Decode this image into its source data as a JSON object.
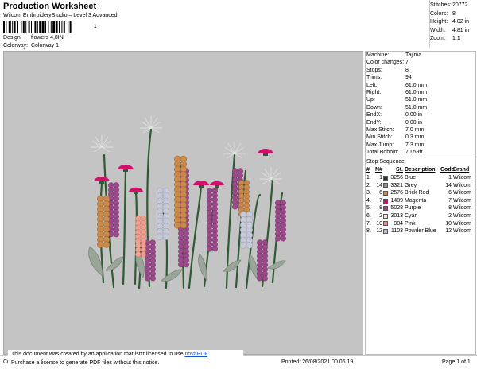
{
  "header": {
    "title": "Production Worksheet",
    "subtitle": "Wilcom EmbroideryStudio – Level 3 Advanced",
    "barcode_suffix": "1",
    "design_label": "Design:",
    "design_value": "flowers 4,8IN",
    "colorway_label": "Colorway:",
    "colorway_value": "Colorway 1"
  },
  "summary": [
    {
      "label": "Stitches:",
      "value": "20772"
    },
    {
      "label": "Colors:",
      "value": "8"
    },
    {
      "label": "Height:",
      "value": "4.02 in"
    },
    {
      "label": "Width:",
      "value": "4.81 in"
    },
    {
      "label": "Zoom:",
      "value": "1:1"
    }
  ],
  "machine_info": [
    {
      "label": "Machine:",
      "value": "Tajima"
    },
    {
      "label": "Color changes:",
      "value": "7"
    },
    {
      "label": "Stops:",
      "value": "8"
    },
    {
      "label": "Trims:",
      "value": "94"
    },
    {
      "label": "Left:",
      "value": "61.0 mm"
    },
    {
      "label": "Right:",
      "value": "61.0 mm"
    },
    {
      "label": "Up:",
      "value": "51.0 mm"
    },
    {
      "label": "Down:",
      "value": "51.0 mm"
    },
    {
      "label": "EndX:",
      "value": "0.00 in"
    },
    {
      "label": "EndY:",
      "value": "0.00 in"
    },
    {
      "label": "Max Stitch:",
      "value": "7.0 mm"
    },
    {
      "label": "Min Stitch:",
      "value": "0.3 mm"
    },
    {
      "label": "Max Jump:",
      "value": "7.3 mm"
    },
    {
      "label": "Total Bobbin:",
      "value": "70.59ft"
    }
  ],
  "stop_sequence": {
    "title": "Stop Sequence:",
    "headers": {
      "num": "#",
      "n": "N#",
      "st": "St.",
      "desc": "Description",
      "code": "Code",
      "brand": "Brand"
    },
    "rows": [
      {
        "num": "1.",
        "n": "1",
        "color": "#1e3a22",
        "st": "3256",
        "desc": "Blue",
        "code": "1",
        "brand": "Wilcom"
      },
      {
        "num": "2.",
        "n": "14",
        "color": "#8a8a8a",
        "st": "3321",
        "desc": "Grey",
        "code": "14",
        "brand": "Wilcom"
      },
      {
        "num": "3.",
        "n": "6",
        "color": "#c98a4a",
        "st": "2576",
        "desc": "Brick Red",
        "code": "6",
        "brand": "Wilcom"
      },
      {
        "num": "4.",
        "n": "7",
        "color": "#d0106a",
        "st": "1489",
        "desc": "Magenta",
        "code": "7",
        "brand": "Wilcom"
      },
      {
        "num": "5.",
        "n": "8",
        "color": "#9a4a8a",
        "st": "5028",
        "desc": "Purple",
        "code": "8",
        "brand": "Wilcom"
      },
      {
        "num": "6.",
        "n": "2",
        "color": "#f2e6e6",
        "st": "3013",
        "desc": "Cyan",
        "code": "2",
        "brand": "Wilcom"
      },
      {
        "num": "7.",
        "n": "10",
        "color": "#f08a8a",
        "st": "984",
        "desc": "Pink",
        "code": "10",
        "brand": "Wilcom"
      },
      {
        "num": "8.",
        "n": "12",
        "color": "#b8bcd4",
        "st": "1103",
        "desc": "Powder Blue",
        "code": "12",
        "brand": "Wilcom"
      }
    ]
  },
  "footer": {
    "left": "Cr",
    "printed": "Printed: 26/08/2021 00.06.19",
    "page": "Page 1 of 1"
  },
  "notice": {
    "line1": "This document was created by an application that isn't licensed to use",
    "link": "novaPDF",
    "line1_end": ".",
    "line2": "Purchase a license to generate PDF files without this notice."
  }
}
